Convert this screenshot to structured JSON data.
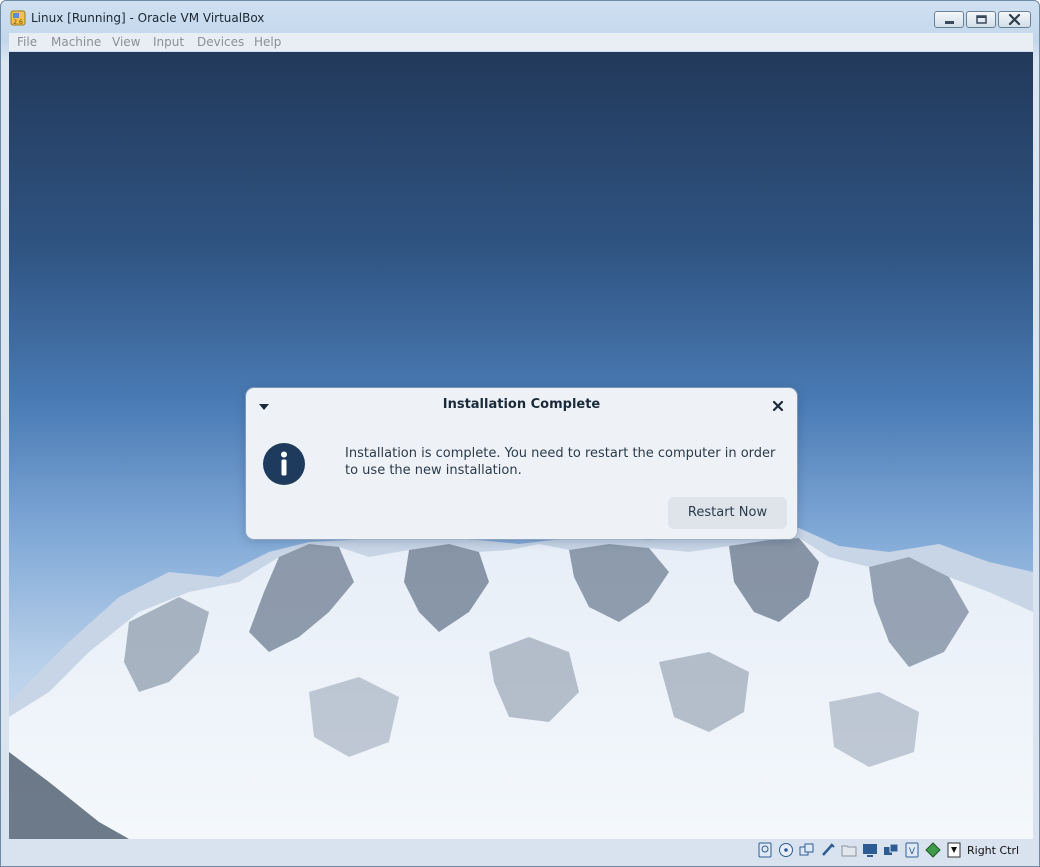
{
  "window": {
    "title": "Linux [Running] - Oracle VM VirtualBox",
    "controls": [
      "minimize-icon",
      "maximize-icon",
      "close-icon"
    ]
  },
  "menubar": {
    "items": [
      "File",
      "Machine",
      "View",
      "Input",
      "Devices",
      "Help"
    ]
  },
  "dialog": {
    "title": "Installation Complete",
    "message": "Installation is complete. You need to restart the computer in order to use the new installation.",
    "button": "Restart Now",
    "icon": "info-icon"
  },
  "statusbar": {
    "icons": [
      "hard-disk-icon",
      "optical-drive-icon",
      "audio-icon",
      "usb-icon",
      "shared-folder-icon",
      "display-icon",
      "network-icon",
      "video-capture-icon",
      "cpu-icon",
      "mouse-integration-icon",
      "host-key-icon"
    ],
    "host_key": "Right Ctrl"
  },
  "colors": {
    "dialog_bg": "#eef1f5",
    "info_icon": "#1e3b5e",
    "button_bg": "#dfe4eb",
    "sky_top": "#22395a",
    "sky_bottom": "#dbe7f4"
  }
}
